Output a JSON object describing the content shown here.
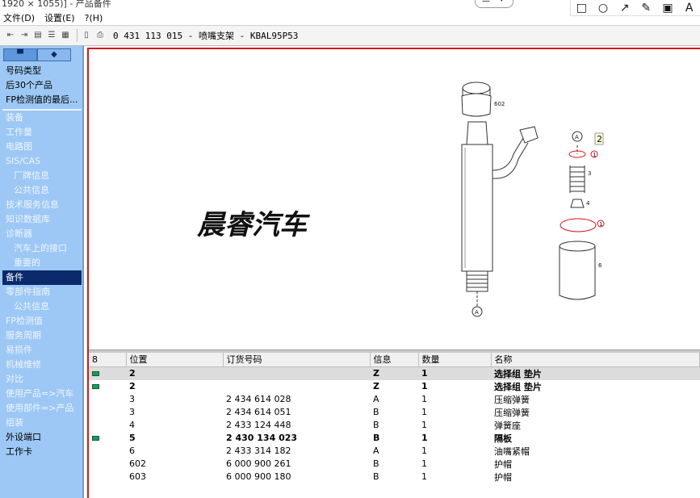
{
  "window": {
    "title": "1920 × 1055)] - 产品备件"
  },
  "overlay_tools": [
    "square-icon",
    "circle-icon",
    "arrow-icon",
    "pencil-icon",
    "mosaic-icon",
    "text-icon"
  ],
  "overlay_tool_glyphs": {
    "text": "A"
  },
  "menubar": [
    {
      "label": "文件(D)"
    },
    {
      "label": "设置(E)"
    },
    {
      "label": "?(H)"
    }
  ],
  "toolbar": {
    "part_label": "0 431 113 015 - 喷嘴支架 - KBAL95P53"
  },
  "sidebar": {
    "tabs": [
      "vehicle",
      "parts"
    ],
    "top_items": [
      {
        "label": "号码类型"
      },
      {
        "label": "后30个产品"
      },
      {
        "label": "FP检测值的最后..."
      }
    ],
    "items": [
      {
        "label": "装备",
        "state": "disabled"
      },
      {
        "label": "工作量",
        "state": "disabled"
      },
      {
        "label": "电路图",
        "state": "disabled"
      },
      {
        "label": "SIS/CAS",
        "state": "disabled"
      },
      {
        "label": "厂牌信息",
        "state": "disabled",
        "indent": true
      },
      {
        "label": "公共信息",
        "state": "disabled",
        "indent": true
      },
      {
        "label": "技术服务信息",
        "state": "disabled"
      },
      {
        "label": "知识数据库",
        "state": "disabled"
      },
      {
        "label": "诊断器",
        "state": "disabled"
      },
      {
        "label": "汽车上的接口",
        "state": "disabled",
        "indent": true
      },
      {
        "label": "重要的",
        "state": "disabled",
        "indent": true
      },
      {
        "label": "备件",
        "state": "selected"
      },
      {
        "label": "零部件指南",
        "state": "disabled"
      },
      {
        "label": "公共信息",
        "state": "disabled",
        "indent": true
      },
      {
        "label": "FP检测值",
        "state": "disabled"
      },
      {
        "label": "服务周期",
        "state": "disabled"
      },
      {
        "label": "易损件",
        "state": "disabled"
      },
      {
        "label": "机械维修",
        "state": "disabled"
      },
      {
        "label": "对比",
        "state": "disabled"
      },
      {
        "label": "使用产品=>汽车",
        "state": "disabled"
      },
      {
        "label": "使用部件=>产品",
        "state": "disabled"
      },
      {
        "label": "组装",
        "state": "disabled"
      },
      {
        "label": "外设端口",
        "state": "enabled"
      },
      {
        "label": "工作卡",
        "state": "enabled"
      }
    ]
  },
  "drawing": {
    "watermark": "晨睿汽车",
    "callouts": [
      "602",
      "A",
      "2",
      "1",
      "1",
      "4",
      "3",
      "6",
      "A"
    ]
  },
  "parts_table": {
    "columns": [
      "8",
      "位置",
      "订货号码",
      "信息",
      "数量",
      "名称"
    ],
    "rows": [
      {
        "flag": true,
        "pos": "2",
        "order": "",
        "info": "Z",
        "qty": "1",
        "name": "选择组 垫片",
        "group": true,
        "selected": true
      },
      {
        "flag": true,
        "pos": "2",
        "order": "",
        "info": "Z",
        "qty": "1",
        "name": "选择组 垫片",
        "group": true,
        "selected": false
      },
      {
        "flag": false,
        "pos": "3",
        "order": "2 434 614 028",
        "info": "A",
        "qty": "1",
        "name": "压缩弹簧",
        "group": false,
        "selected": false
      },
      {
        "flag": false,
        "pos": "3",
        "order": "2 434 614 051",
        "info": "B",
        "qty": "1",
        "name": "压缩弹簧",
        "group": false,
        "selected": false
      },
      {
        "flag": false,
        "pos": "4",
        "order": "2 433 124 448",
        "info": "B",
        "qty": "1",
        "name": "弹簧座",
        "group": false,
        "selected": false
      },
      {
        "flag": true,
        "pos": "5",
        "order": "2 430 134 023",
        "info": "B",
        "qty": "1",
        "name": "隔板",
        "group": true,
        "selected": false
      },
      {
        "flag": false,
        "pos": "6",
        "order": "2 433 314 182",
        "info": "A",
        "qty": "1",
        "name": "油嘴紧帽",
        "group": false,
        "selected": false
      },
      {
        "flag": false,
        "pos": "602",
        "order": "6 000 900 261",
        "info": "B",
        "qty": "1",
        "name": "护帽",
        "group": false,
        "selected": false
      },
      {
        "flag": false,
        "pos": "603",
        "order": "6 000 900 180",
        "info": "B",
        "qty": "1",
        "name": "护帽",
        "group": false,
        "selected": false
      }
    ]
  }
}
